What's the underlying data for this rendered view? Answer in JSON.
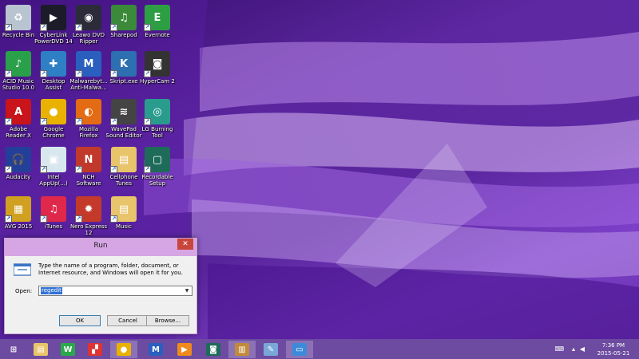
{
  "desktop": {
    "icons": [
      {
        "label": "Recycle Bin",
        "icon": "recycle-bin-icon",
        "color": "#b8c4d0",
        "glyph": "♻"
      },
      {
        "label": "CyberLink\nPowerDVD 14",
        "icon": "powerdvd-icon",
        "color": "#1b1b2a",
        "glyph": "▶"
      },
      {
        "label": "Leawo DVD\nRipper",
        "icon": "leawo-dvd-ripper-icon",
        "color": "#2b2b3a",
        "glyph": "◉"
      },
      {
        "label": "Sharepod",
        "icon": "sharepod-icon",
        "color": "#3a8a3a",
        "glyph": "♫"
      },
      {
        "label": "Evernote",
        "icon": "evernote-icon",
        "color": "#2e9e44",
        "glyph": "E"
      },
      {
        "label": "ACID Music\nStudio 10.0",
        "icon": "acid-music-studio-icon",
        "color": "#2aa04a",
        "glyph": "♪"
      },
      {
        "label": "Desktop\nAssist",
        "icon": "desktop-assist-icon",
        "color": "#2f7fc4",
        "glyph": "✚"
      },
      {
        "label": "Malwarebyt...\nAnti-Malwa...",
        "icon": "malwarebytes-icon",
        "color": "#2a5fbf",
        "glyph": "M"
      },
      {
        "label": "Skript.exe",
        "icon": "skript-icon",
        "color": "#2d6fb0",
        "glyph": "K"
      },
      {
        "label": "HyperCam 2",
        "icon": "hypercam-icon",
        "color": "#333333",
        "glyph": "◙"
      },
      {
        "label": "Adobe\nReader X",
        "icon": "adobe-reader-icon",
        "color": "#c8141a",
        "glyph": "A"
      },
      {
        "label": "Google\nChrome",
        "icon": "chrome-icon",
        "color": "#e9b200",
        "glyph": "●"
      },
      {
        "label": "Mozilla\nFirefox",
        "icon": "firefox-icon",
        "color": "#e36b14",
        "glyph": "◐"
      },
      {
        "label": "WavePad\nSound Editor",
        "icon": "wavepad-icon",
        "color": "#444444",
        "glyph": "≋"
      },
      {
        "label": "LG Burning\nTool",
        "icon": "lg-burning-tool-icon",
        "color": "#2a9c8e",
        "glyph": "◎"
      },
      {
        "label": "Audacity",
        "icon": "audacity-icon",
        "color": "#243f9a",
        "glyph": "🎧"
      },
      {
        "label": "Intel\nAppUp(...)",
        "icon": "intel-appup-icon",
        "color": "#d8e6ee",
        "glyph": "▣"
      },
      {
        "label": "NCH\nSoftware",
        "icon": "nch-software-icon",
        "color": "#c0392b",
        "glyph": "N"
      },
      {
        "label": "Cellphone\nTunes",
        "icon": "folder-icon",
        "color": "#e8c46a",
        "glyph": "▤"
      },
      {
        "label": "Recordable\nSetup",
        "icon": "recordable-setup-icon",
        "color": "#1e6b5a",
        "glyph": "▢"
      },
      {
        "label": "AVG 2015",
        "icon": "avg-icon",
        "color": "#d0a020",
        "glyph": "▦"
      },
      {
        "label": "iTunes",
        "icon": "itunes-icon",
        "color": "#e0284a",
        "glyph": "♫"
      },
      {
        "label": "Nero Express\n12",
        "icon": "nero-express-icon",
        "color": "#c33a2a",
        "glyph": "✹"
      },
      {
        "label": "Music",
        "icon": "folder-icon",
        "color": "#e8c46a",
        "glyph": "▤"
      }
    ]
  },
  "run_dialog": {
    "title": "Run",
    "close_label": "✕",
    "description": "Type the name of a program, folder, document, or Internet resource, and Windows will open it for you.",
    "open_label": "Open:",
    "open_value": "regedit",
    "ok_label": "OK",
    "cancel_label": "Cancel",
    "browse_label": "Browse..."
  },
  "taskbar": {
    "items": [
      {
        "icon": "windows-start-icon",
        "color": "#6c4ba0",
        "glyph": "⊞",
        "active": false
      },
      {
        "icon": "file-explorer-icon",
        "color": "#e8c46a",
        "glyph": "▤",
        "active": false
      },
      {
        "icon": "winzip-icon",
        "color": "#2ba84a",
        "glyph": "W",
        "active": false
      },
      {
        "icon": "puzzle-app-icon",
        "color": "#d33",
        "glyph": "▞",
        "active": false
      },
      {
        "icon": "chrome-icon",
        "color": "#e9b200",
        "glyph": "●",
        "active": true
      },
      {
        "icon": "malwarebytes-icon",
        "color": "#2a5fbf",
        "glyph": "M",
        "active": false
      },
      {
        "icon": "media-player-icon",
        "color": "#f08a1c",
        "glyph": "▶",
        "active": false
      },
      {
        "icon": "recorder-icon",
        "color": "#1e6b5a",
        "glyph": "◙",
        "active": false
      },
      {
        "icon": "library-icon",
        "color": "#c28a3a",
        "glyph": "▥",
        "active": true
      },
      {
        "icon": "paint-icon",
        "color": "#7aa7d8",
        "glyph": "✎",
        "active": false
      },
      {
        "icon": "run-icon",
        "color": "#3c8ad9",
        "glyph": "▭",
        "active": true
      }
    ],
    "tray": {
      "keyboard_icon": "keyboard-icon",
      "time": "7:36 PM",
      "date": "2015-05-21"
    }
  }
}
